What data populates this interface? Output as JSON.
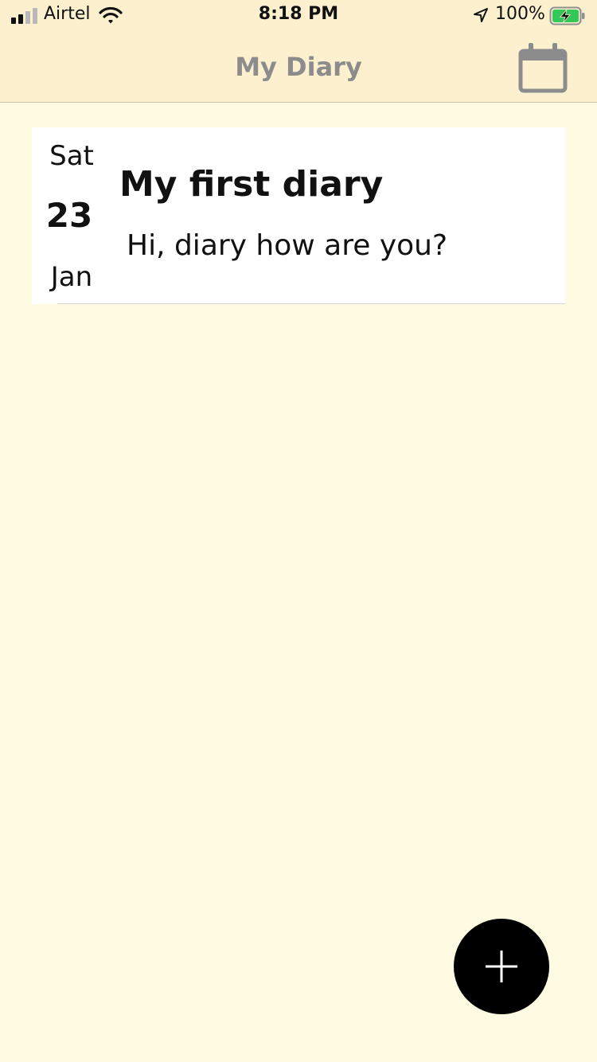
{
  "status_bar": {
    "carrier": "Airtel",
    "time": "8:18 PM",
    "battery_percent": "100%",
    "signal_bars_filled": 2,
    "signal_bars_total": 4,
    "icons": [
      "signal-icon",
      "wifi-icon",
      "location-arrow-icon",
      "battery-charging-icon"
    ],
    "battery_color": "#34c759"
  },
  "header": {
    "title": "My Diary",
    "calendar_icon": "calendar-icon"
  },
  "entries": [
    {
      "weekday": "Sat",
      "day": "23",
      "month": "Jan",
      "title": "My first diary",
      "body": "Hi, diary how are you?"
    }
  ],
  "fab": {
    "icon": "plus-icon"
  },
  "colors": {
    "background": "#fffbe3",
    "header_background": "#fcf0cf",
    "title_gray": "#8c8c8c",
    "card": "#ffffff",
    "fab": "#000000"
  }
}
